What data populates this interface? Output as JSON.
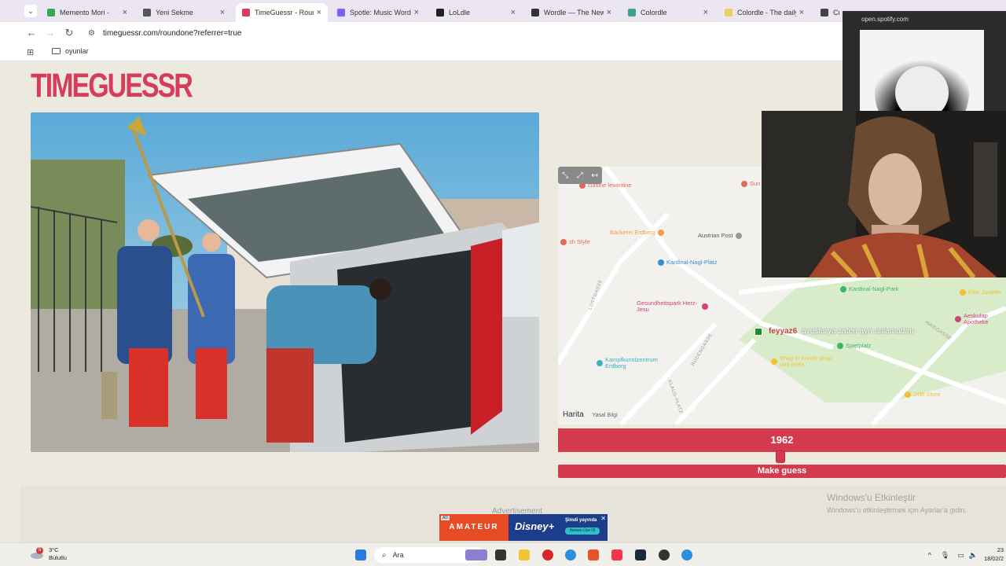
{
  "browser": {
    "tabs": [
      {
        "title": "Memento Mori -",
        "color": "#34a853",
        "active": false
      },
      {
        "title": "Yeni Sekme",
        "color": "#555555",
        "active": false
      },
      {
        "title": "TimeGuessr - Round",
        "color": "#d63d5a",
        "active": true
      },
      {
        "title": "Spotle: Music Wordle",
        "color": "#7b61ff",
        "active": false
      },
      {
        "title": "LoLdle",
        "color": "#222222",
        "active": false
      },
      {
        "title": "Wordle — The New Y",
        "color": "#333333",
        "active": false
      },
      {
        "title": "Colordle",
        "color": "#3aa38a",
        "active": false
      },
      {
        "title": "Colordle - The daily c",
        "color": "#e8d35a",
        "active": false
      },
      {
        "title": "Cryp",
        "color": "#444444",
        "active": false
      }
    ],
    "url": "timeguessr.com/roundone?referrer=true",
    "bookmark_folder": "oyunlar"
  },
  "game": {
    "logo": "TIMEGUESSR",
    "year": "1962",
    "guess_button": "Make guess"
  },
  "map": {
    "attribution": "Harita",
    "legal": "Yasal Bilgi",
    "pois": [
      {
        "label": "cuisine levantine",
        "color": "#e06a5a"
      },
      {
        "label": "Bäckerei Erdberg",
        "color": "#f0a040"
      },
      {
        "label": "Austrian Post",
        "color": "#9a9a9a"
      },
      {
        "label": "Kardinal-Nagl-Platz",
        "color": "#3a8fd0"
      },
      {
        "label": "Gesundheitspark Herz-Jesu",
        "color": "#d0437a"
      },
      {
        "label": "Kardinal-Nagl-Park",
        "color": "#3fb56a"
      },
      {
        "label": "Elite Juweler",
        "color": "#f2c034"
      },
      {
        "label": "Aeskulap Apotheke",
        "color": "#d0437a"
      },
      {
        "label": "Spielplatz",
        "color": "#3fb56a"
      },
      {
        "label": "Kampfkunstzentrum Erdberg",
        "color": "#3ab0c0"
      },
      {
        "label": "Shop in handy shop und mehr",
        "color": "#f2c034"
      },
      {
        "label": "24th Store",
        "color": "#f2c034"
      },
      {
        "label": "sh Style",
        "color": "#e06a5a"
      },
      {
        "label": "Sun & bar",
        "color": "#e06a5a"
      }
    ],
    "streets": [
      "LUSTGASSE",
      "RÜDENGASSE",
      "HAIDGASSE",
      "KLAUS-PLATZ"
    ]
  },
  "chat": {
    "user": "feyyaz6",
    "text": "avusturya zaten ayrı anlamadım"
  },
  "ad": {
    "label": "Advertisement",
    "tag": "AD",
    "left_text": "AMATEUR",
    "brand": "Disney+",
    "cta_top": "Şimdi yayında",
    "cta_bottom": "Hemen Üye Ol"
  },
  "spotify": {
    "url": "open.spotify.com"
  },
  "windows": {
    "activate_title": "Windows'u Etkinleştir",
    "activate_sub": "Windows'u etkinleştirmek için Ayarlar'a gidin.",
    "weather_temp": "3°C",
    "weather_desc": "Bulutlu",
    "weather_badge": "5",
    "search_placeholder": "Ara",
    "time": "23",
    "date": "18/02/2"
  }
}
